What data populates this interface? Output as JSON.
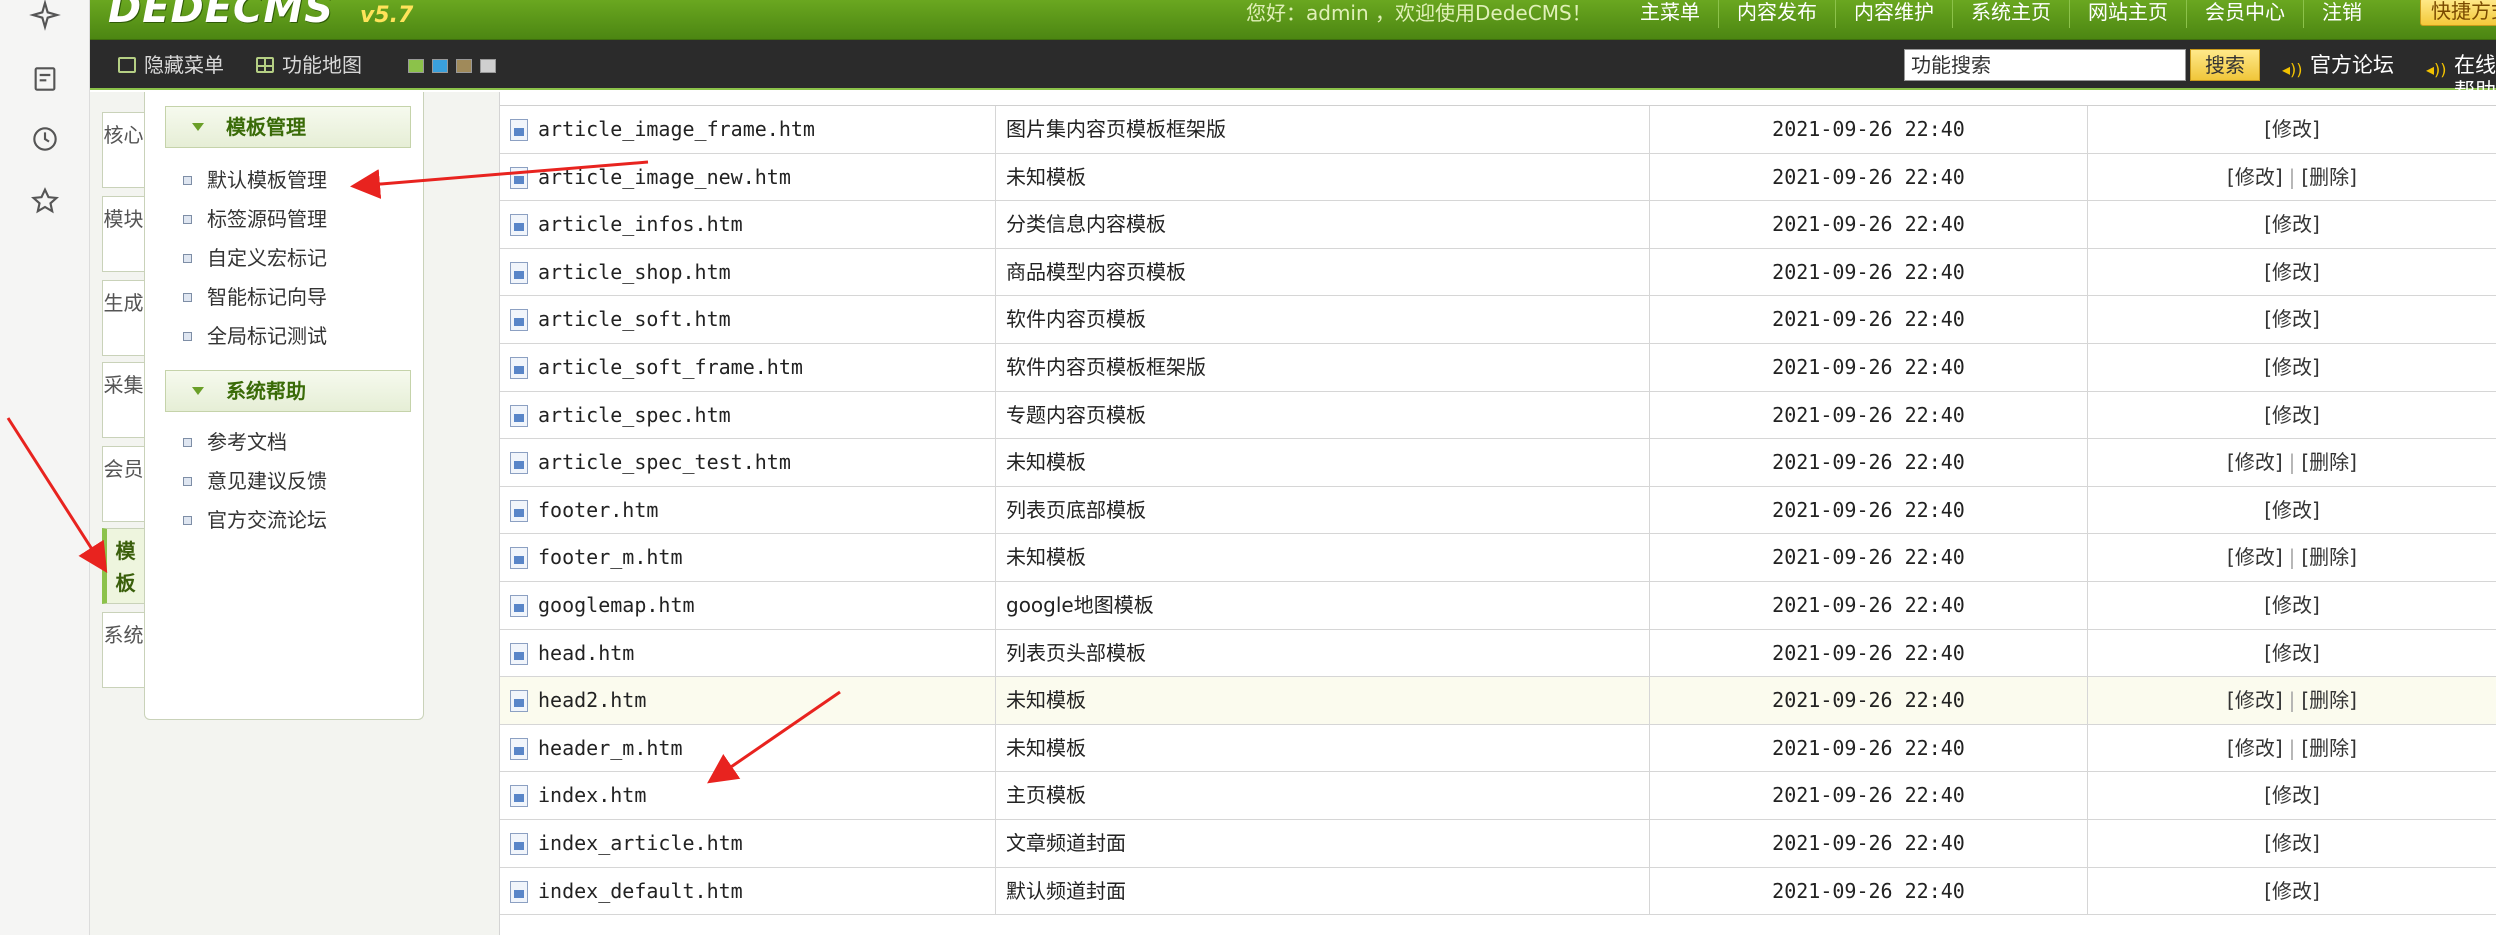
{
  "header": {
    "logo": "DEDECMS",
    "version": "v5.7",
    "greeting": "您好：admin ，欢迎使用DedeCMS！",
    "nav": [
      "主菜单",
      "内容发布",
      "内容维护",
      "系统主页",
      "网站主页",
      "会员中心",
      "注销"
    ],
    "shortcut": "快捷方式"
  },
  "toolbar": {
    "hide_menu": "隐藏菜单",
    "func_map": "功能地图",
    "skin_colors": [
      "#8cc24a",
      "#3aa0dc",
      "#a08a5a",
      "#cfcfcf"
    ],
    "search_value": "功能搜索",
    "search_button": "搜索",
    "forum": "官方论坛",
    "help": "在线帮助"
  },
  "vtabs": [
    "核心",
    "模块",
    "生成",
    "采集",
    "会员",
    "模板",
    "系统"
  ],
  "menu": {
    "template_group": "模板管理",
    "template_items": [
      "默认模板管理",
      "标签源码管理",
      "自定义宏标记",
      "智能标记向导",
      "全局标记测试"
    ],
    "help_group": "系统帮助",
    "help_items": [
      "参考文档",
      "意见建议反馈",
      "官方交流论坛"
    ]
  },
  "table": {
    "rows": [
      {
        "name": "article_image_frame.htm",
        "desc": "图片集内容页模板框架版",
        "time": "2021-09-26 22:40",
        "edit": "[修改]",
        "del": ""
      },
      {
        "name": "article_image_new.htm",
        "desc": "未知模板",
        "time": "2021-09-26 22:40",
        "edit": "[修改]",
        "del": "[删除]"
      },
      {
        "name": "article_infos.htm",
        "desc": "分类信息内容模板",
        "time": "2021-09-26 22:40",
        "edit": "[修改]",
        "del": ""
      },
      {
        "name": "article_shop.htm",
        "desc": "商品模型内容页模板",
        "time": "2021-09-26 22:40",
        "edit": "[修改]",
        "del": ""
      },
      {
        "name": "article_soft.htm",
        "desc": "软件内容页模板",
        "time": "2021-09-26 22:40",
        "edit": "[修改]",
        "del": ""
      },
      {
        "name": "article_soft_frame.htm",
        "desc": "软件内容页模板框架版",
        "time": "2021-09-26 22:40",
        "edit": "[修改]",
        "del": ""
      },
      {
        "name": "article_spec.htm",
        "desc": "专题内容页模板",
        "time": "2021-09-26 22:40",
        "edit": "[修改]",
        "del": ""
      },
      {
        "name": "article_spec_test.htm",
        "desc": "未知模板",
        "time": "2021-09-26 22:40",
        "edit": "[修改]",
        "del": "[删除]"
      },
      {
        "name": "footer.htm",
        "desc": "列表页底部模板",
        "time": "2021-09-26 22:40",
        "edit": "[修改]",
        "del": ""
      },
      {
        "name": "footer_m.htm",
        "desc": "未知模板",
        "time": "2021-09-26 22:40",
        "edit": "[修改]",
        "del": "[删除]"
      },
      {
        "name": "googlemap.htm",
        "desc": "google地图模板",
        "time": "2021-09-26 22:40",
        "edit": "[修改]",
        "del": ""
      },
      {
        "name": "head.htm",
        "desc": "列表页头部模板",
        "time": "2021-09-26 22:40",
        "edit": "[修改]",
        "del": ""
      },
      {
        "name": "head2.htm",
        "desc": "未知模板",
        "time": "2021-09-26 22:40",
        "edit": "[修改]",
        "del": "[删除]"
      },
      {
        "name": "header_m.htm",
        "desc": "未知模板",
        "time": "2021-09-26 22:40",
        "edit": "[修改]",
        "del": "[删除]"
      },
      {
        "name": "index.htm",
        "desc": "主页模板",
        "time": "2021-09-26 22:40",
        "edit": "[修改]",
        "del": ""
      },
      {
        "name": "index_article.htm",
        "desc": "文章频道封面",
        "time": "2021-09-26 22:40",
        "edit": "[修改]",
        "del": ""
      },
      {
        "name": "index_default.htm",
        "desc": "默认频道封面",
        "time": "2021-09-26 22:40",
        "edit": "[修改]",
        "del": ""
      }
    ]
  }
}
